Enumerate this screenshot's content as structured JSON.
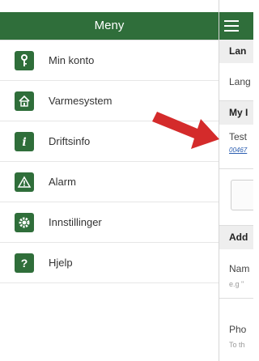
{
  "menu": {
    "title": "Meny",
    "items": [
      {
        "label": "Min konto",
        "icon": "key-icon"
      },
      {
        "label": "Varmesystem",
        "icon": "house-icon"
      },
      {
        "label": "Driftsinfo",
        "icon": "info-icon"
      },
      {
        "label": "Alarm",
        "icon": "warning-icon"
      },
      {
        "label": "Innstillinger",
        "icon": "gear-icon"
      },
      {
        "label": "Hjelp",
        "icon": "help-icon"
      }
    ]
  },
  "main": {
    "menu_icon": "hamburger-icon",
    "sections": {
      "language_header": "Lan",
      "language_row": "Lang",
      "my_header": "My I",
      "test_label": "Test",
      "test_link": "00467",
      "add_header": "Add",
      "name_label": "Nam",
      "name_hint": "e.g \"",
      "phone_label": "Pho",
      "phone_hint": "To th"
    }
  },
  "colors": {
    "brand_green": "#2f6e3a",
    "arrow_red": "#d42b2b",
    "section_bg": "#eeeeee"
  }
}
